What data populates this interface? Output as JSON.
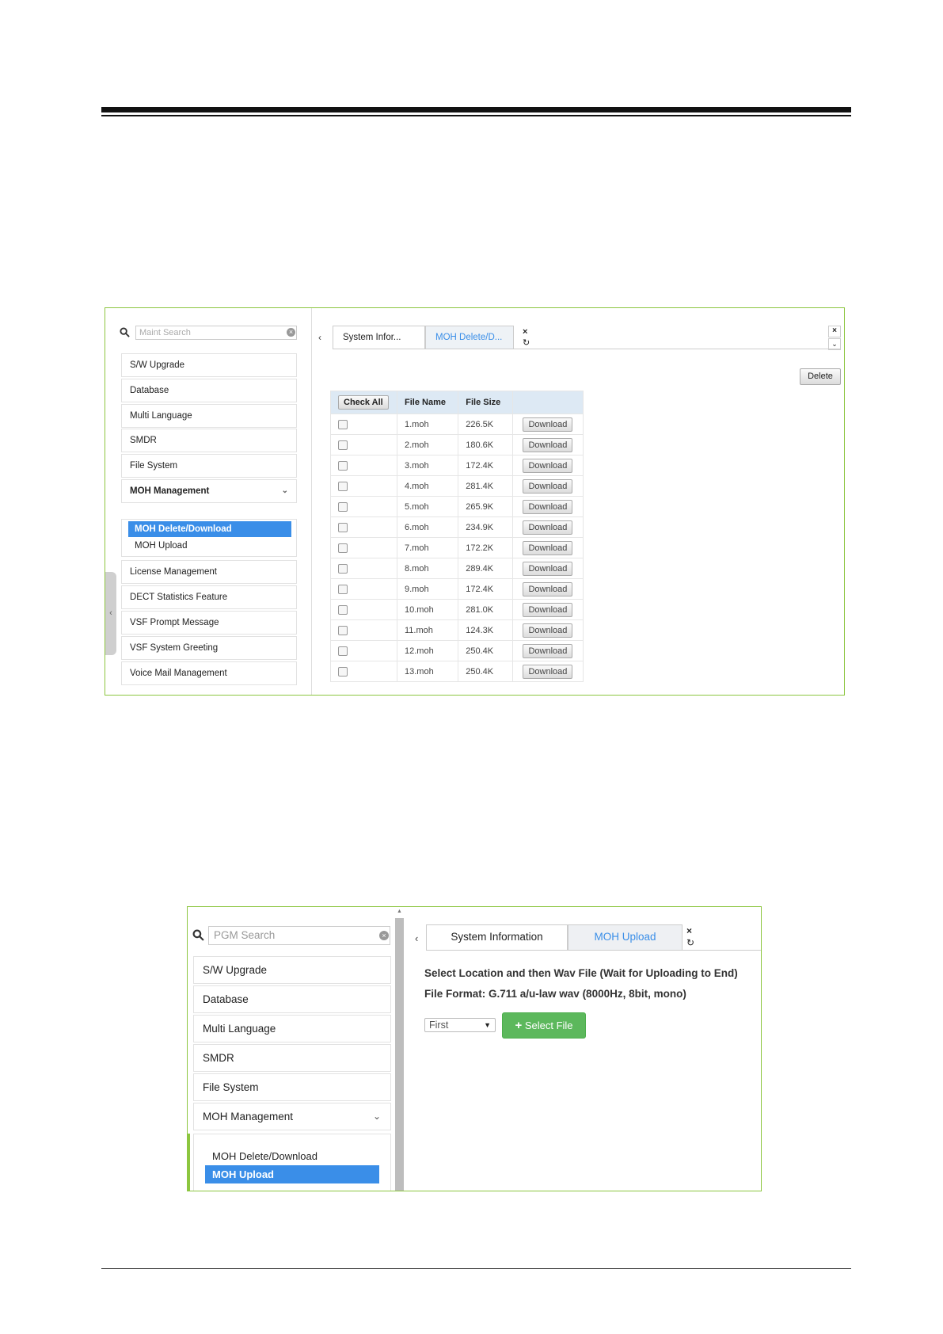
{
  "screen1": {
    "search_placeholder": "Maint Search",
    "menu": [
      {
        "label": "S/W Upgrade"
      },
      {
        "label": "Database"
      },
      {
        "label": "Multi Language"
      },
      {
        "label": "SMDR"
      },
      {
        "label": "File System"
      },
      {
        "label": "MOH Management",
        "expanded": true
      },
      {
        "label": "License Management"
      },
      {
        "label": "DECT Statistics Feature"
      },
      {
        "label": "VSF Prompt Message"
      },
      {
        "label": "VSF System Greeting"
      },
      {
        "label": "Voice Mail Management"
      }
    ],
    "submenu": [
      {
        "label": "MOH Delete/Download",
        "active": true
      },
      {
        "label": "MOH Upload",
        "active": false
      }
    ],
    "tabs": [
      {
        "label": "System Infor...",
        "active": false
      },
      {
        "label": "MOH Delete/D...",
        "active": true
      }
    ],
    "delete_label": "Delete",
    "table": {
      "check_all_label": "Check All",
      "columns": [
        "File Name",
        "File Size"
      ],
      "download_label": "Download",
      "rows": [
        {
          "name": "1.moh",
          "size": "226.5K"
        },
        {
          "name": "2.moh",
          "size": "180.6K"
        },
        {
          "name": "3.moh",
          "size": "172.4K"
        },
        {
          "name": "4.moh",
          "size": "281.4K"
        },
        {
          "name": "5.moh",
          "size": "265.9K"
        },
        {
          "name": "6.moh",
          "size": "234.9K"
        },
        {
          "name": "7.moh",
          "size": "172.2K"
        },
        {
          "name": "8.moh",
          "size": "289.4K"
        },
        {
          "name": "9.moh",
          "size": "172.4K"
        },
        {
          "name": "10.moh",
          "size": "281.0K"
        },
        {
          "name": "11.moh",
          "size": "124.3K"
        },
        {
          "name": "12.moh",
          "size": "250.4K"
        },
        {
          "name": "13.moh",
          "size": "250.4K"
        }
      ]
    }
  },
  "screen2": {
    "search_placeholder": "PGM Search",
    "menu": [
      {
        "label": "S/W Upgrade"
      },
      {
        "label": "Database"
      },
      {
        "label": "Multi Language"
      },
      {
        "label": "SMDR"
      },
      {
        "label": "File System"
      },
      {
        "label": "MOH Management",
        "expanded": true
      }
    ],
    "submenu": [
      {
        "label": "MOH Delete/Download",
        "active": false
      },
      {
        "label": "MOH Upload",
        "active": true
      }
    ],
    "tabs": [
      {
        "label": "System Information",
        "active": false
      },
      {
        "label": "MOH Upload",
        "active": true
      }
    ],
    "instruction": "Select Location and then Wav File (Wait for Uploading to End)",
    "file_format": "File Format: G.711 a/u-law wav (8000Hz, 8bit, mono)",
    "location_value": "First",
    "select_file_label": "Select File"
  },
  "colors": {
    "frame_border": "#8cc63f",
    "accent_blue": "#3a8ee8",
    "table_header": "#dde9f4",
    "select_file_green": "#5cb85c"
  }
}
